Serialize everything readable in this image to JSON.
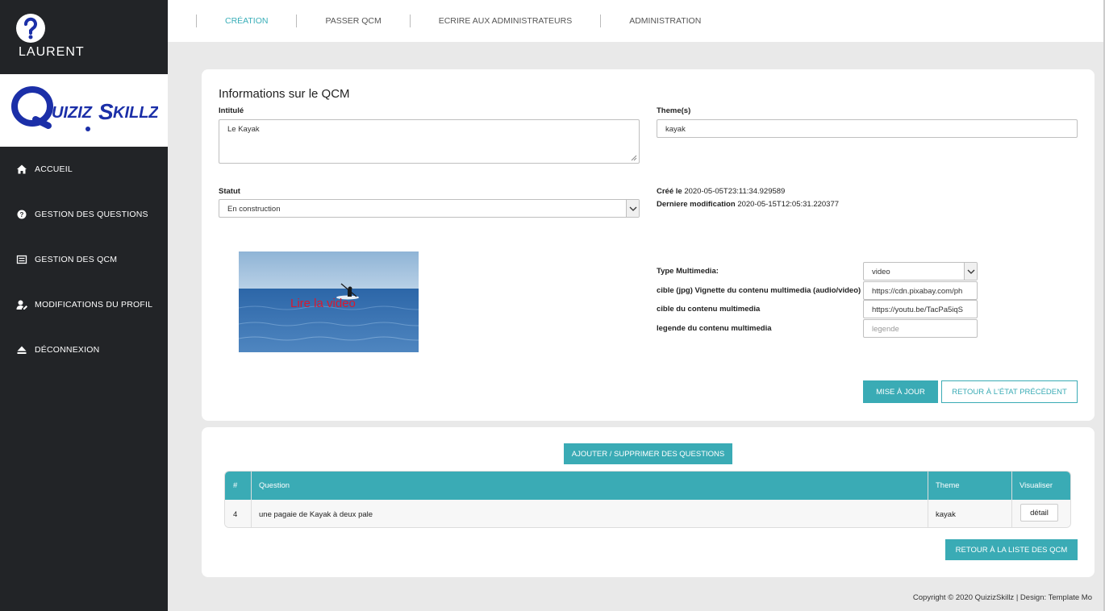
{
  "user": {
    "name": "LAURENT"
  },
  "sidebar": {
    "items": [
      {
        "label": "ACCUEIL",
        "icon": "home-icon"
      },
      {
        "label": "GESTION DES QUESTIONS",
        "icon": "question-circle-icon"
      },
      {
        "label": "GESTION DES QCM",
        "icon": "list-icon"
      },
      {
        "label": "MODIFICATIONS DU PROFIL",
        "icon": "user-edit-icon"
      },
      {
        "label": "DÉCONNEXION",
        "icon": "eject-icon"
      }
    ]
  },
  "topnav": {
    "items": [
      {
        "label": "CRÉATION",
        "active": true
      },
      {
        "label": "PASSER QCM",
        "active": false
      },
      {
        "label": "ECRIRE AUX ADMINISTRATEURS",
        "active": false
      },
      {
        "label": "ADMINISTRATION",
        "active": false
      }
    ]
  },
  "form": {
    "title": "Informations sur le QCM",
    "intitule_label": "Intitulé",
    "intitule_value": "Le Kayak",
    "themes_label": "Theme(s)",
    "themes_value": "kayak",
    "statut_label": "Statut",
    "statut_value": "En construction",
    "created_label": "Créé le",
    "created_value": "2020-05-05T23:11:34.929589",
    "modified_label": "Derniere modification",
    "modified_value": "2020-05-15T12:05:31.220377",
    "media_caption": "Lire la video",
    "type_label": "Type Multimedia:",
    "type_value": "video",
    "thumb_label": "cible (jpg) Vignette du contenu multimedia (audio/video)",
    "thumb_value": "https://cdn.pixabay.com/ph",
    "target_label": "cible du contenu multimedia",
    "target_value": "https://youtu.be/TacPa5iqS",
    "legend_label": "legende du contenu multimedia",
    "legend_placeholder": "legende",
    "update_button": "MISE À JOUR",
    "revert_button": "RETOUR À L'ÉTAT PRÉCÉDENT"
  },
  "questions": {
    "manage_button": "AJOUTER / SUPPRIMER DES QUESTIONS",
    "headers": [
      "#",
      "Question",
      "Theme",
      "Visualiser"
    ],
    "rows": [
      {
        "num": "4",
        "question": "une pagaie de Kayak à deux pale",
        "theme": "kayak",
        "action": "détail"
      }
    ],
    "back_button": "RETOUR À LA LISTE DES QCM"
  },
  "footer": {
    "text": "Copyright © 2020 QuizizSkillz | Design: Template Mo"
  },
  "colors": {
    "accent": "#3aabb5",
    "sidebar": "#222427",
    "caption": "#d9192f",
    "logo": "#1b2fa8"
  }
}
